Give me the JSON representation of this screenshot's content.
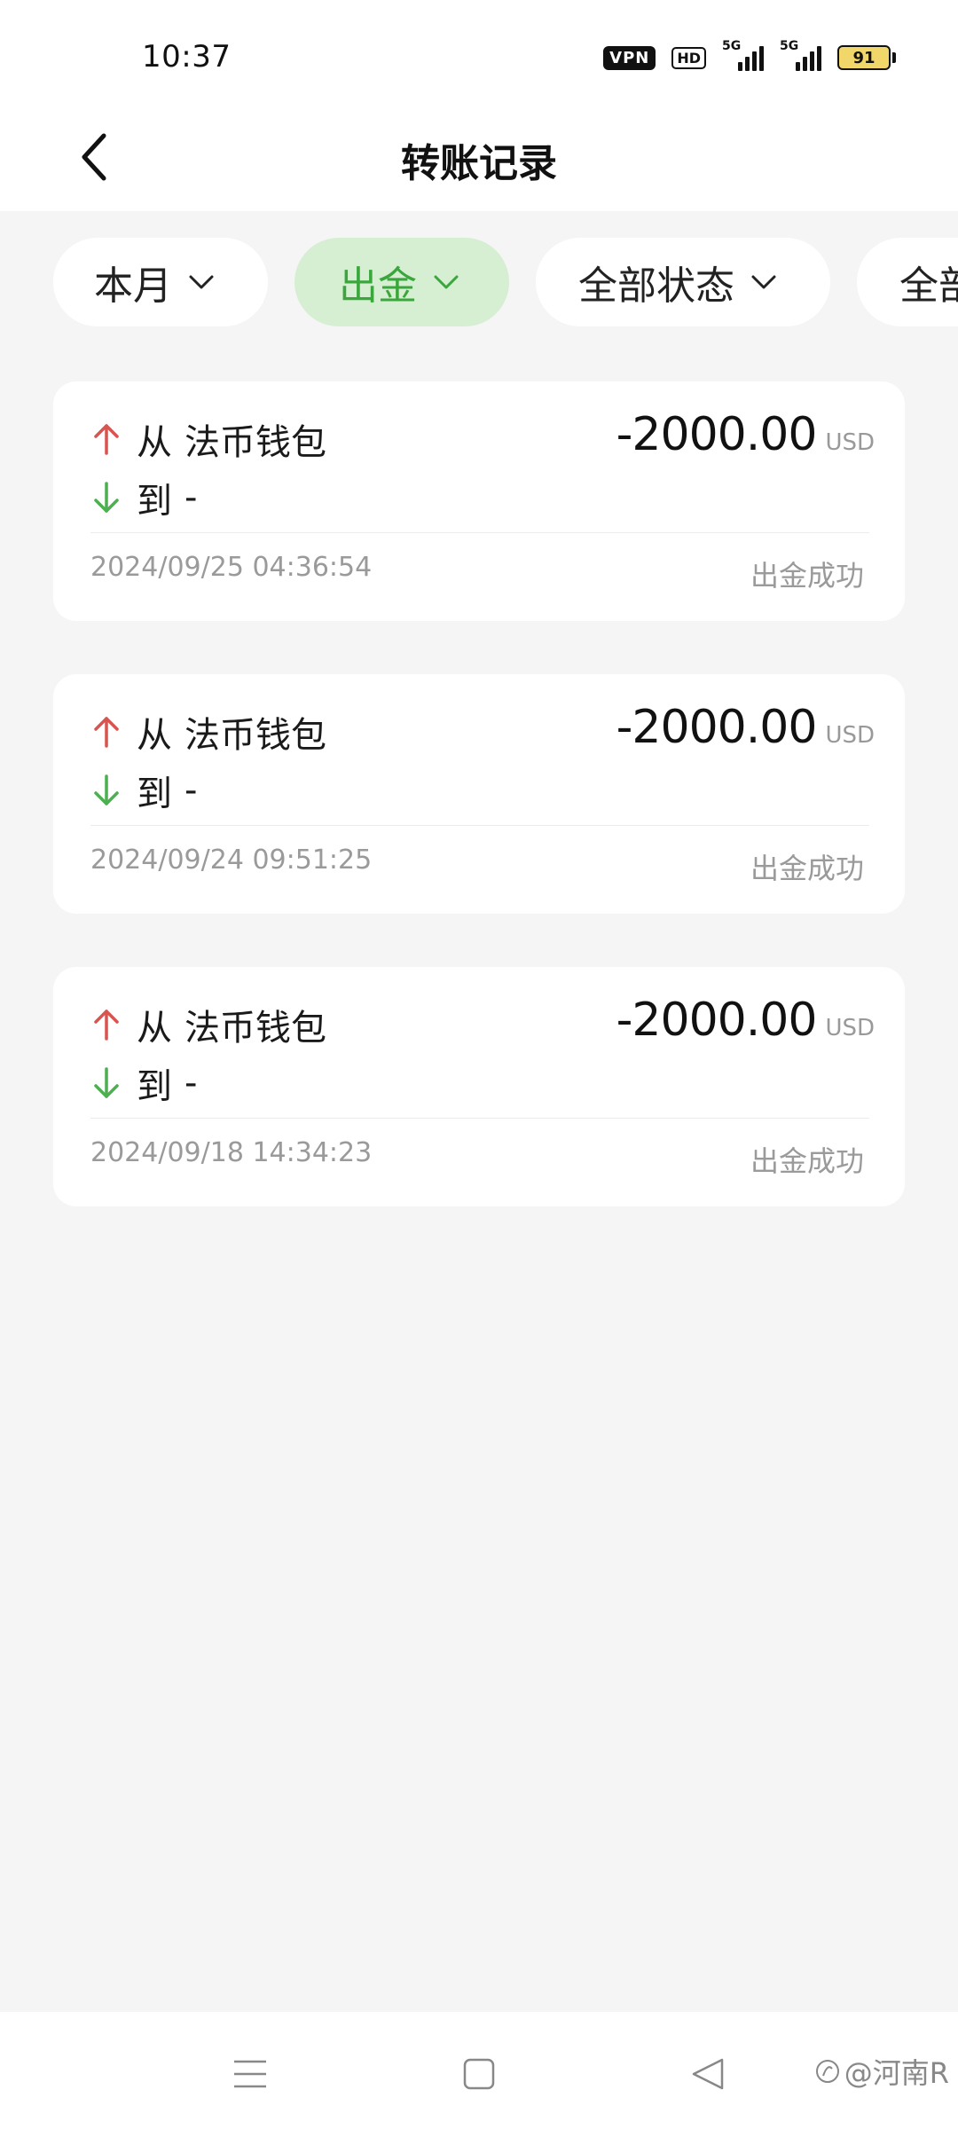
{
  "status_bar": {
    "time": "10:37",
    "vpn": "VPN",
    "hd": "HD",
    "signal1_tag": "5G",
    "signal2_tag": "5G",
    "battery": "91"
  },
  "header": {
    "title": "转账记录"
  },
  "filters": [
    {
      "label": "本月",
      "active": false
    },
    {
      "label": "出金",
      "active": true
    },
    {
      "label": "全部状态",
      "active": false
    },
    {
      "label": "全部",
      "active": false
    }
  ],
  "labels": {
    "from": "从",
    "to": "到"
  },
  "records": [
    {
      "from": "法币钱包",
      "to": "-",
      "amount": "-2000.00",
      "currency": "USD",
      "time": "2024/09/25 04:36:54",
      "status": "出金成功"
    },
    {
      "from": "法币钱包",
      "to": "-",
      "amount": "-2000.00",
      "currency": "USD",
      "time": "2024/09/24 09:51:25",
      "status": "出金成功"
    },
    {
      "from": "法币钱包",
      "to": "-",
      "amount": "-2000.00",
      "currency": "USD",
      "time": "2024/09/18 14:34:23",
      "status": "出金成功"
    }
  ],
  "watermark": "@河南R",
  "colors": {
    "accent_green": "#3aa63c",
    "active_chip_bg": "#d6efd2",
    "arrow_up": "#d9534f",
    "arrow_down": "#4caf50"
  },
  "icons": {
    "back": "chevron-left-icon",
    "chip": "chevron-down-icon",
    "out": "arrow-up-icon",
    "in": "arrow-down-icon",
    "nav_menu": "menu-icon",
    "nav_home": "square-icon",
    "nav_back": "triangle-back-icon"
  }
}
